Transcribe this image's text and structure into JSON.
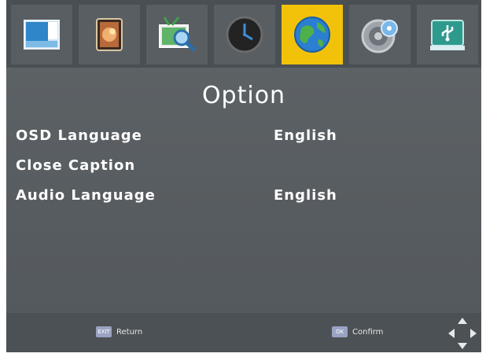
{
  "tabs": [
    {
      "name": "picture-icon",
      "active": false
    },
    {
      "name": "photo-icon",
      "active": false
    },
    {
      "name": "channel-search-icon",
      "active": false
    },
    {
      "name": "clock-icon",
      "active": false
    },
    {
      "name": "globe-icon",
      "active": true
    },
    {
      "name": "settings-disc-icon",
      "active": false
    },
    {
      "name": "usb-icon",
      "active": false
    }
  ],
  "page": {
    "title": "Option"
  },
  "options": [
    {
      "label": "OSD Language",
      "value": "English"
    },
    {
      "label": "Close Caption",
      "value": ""
    },
    {
      "label": "Audio Language",
      "value": "English"
    }
  ],
  "footer": {
    "return_key": "EXIT",
    "return_label": "Return",
    "confirm_key": "OK",
    "confirm_label": "Confirm"
  },
  "colors": {
    "accent": "#f2c20a",
    "background": "#5a5f63"
  }
}
